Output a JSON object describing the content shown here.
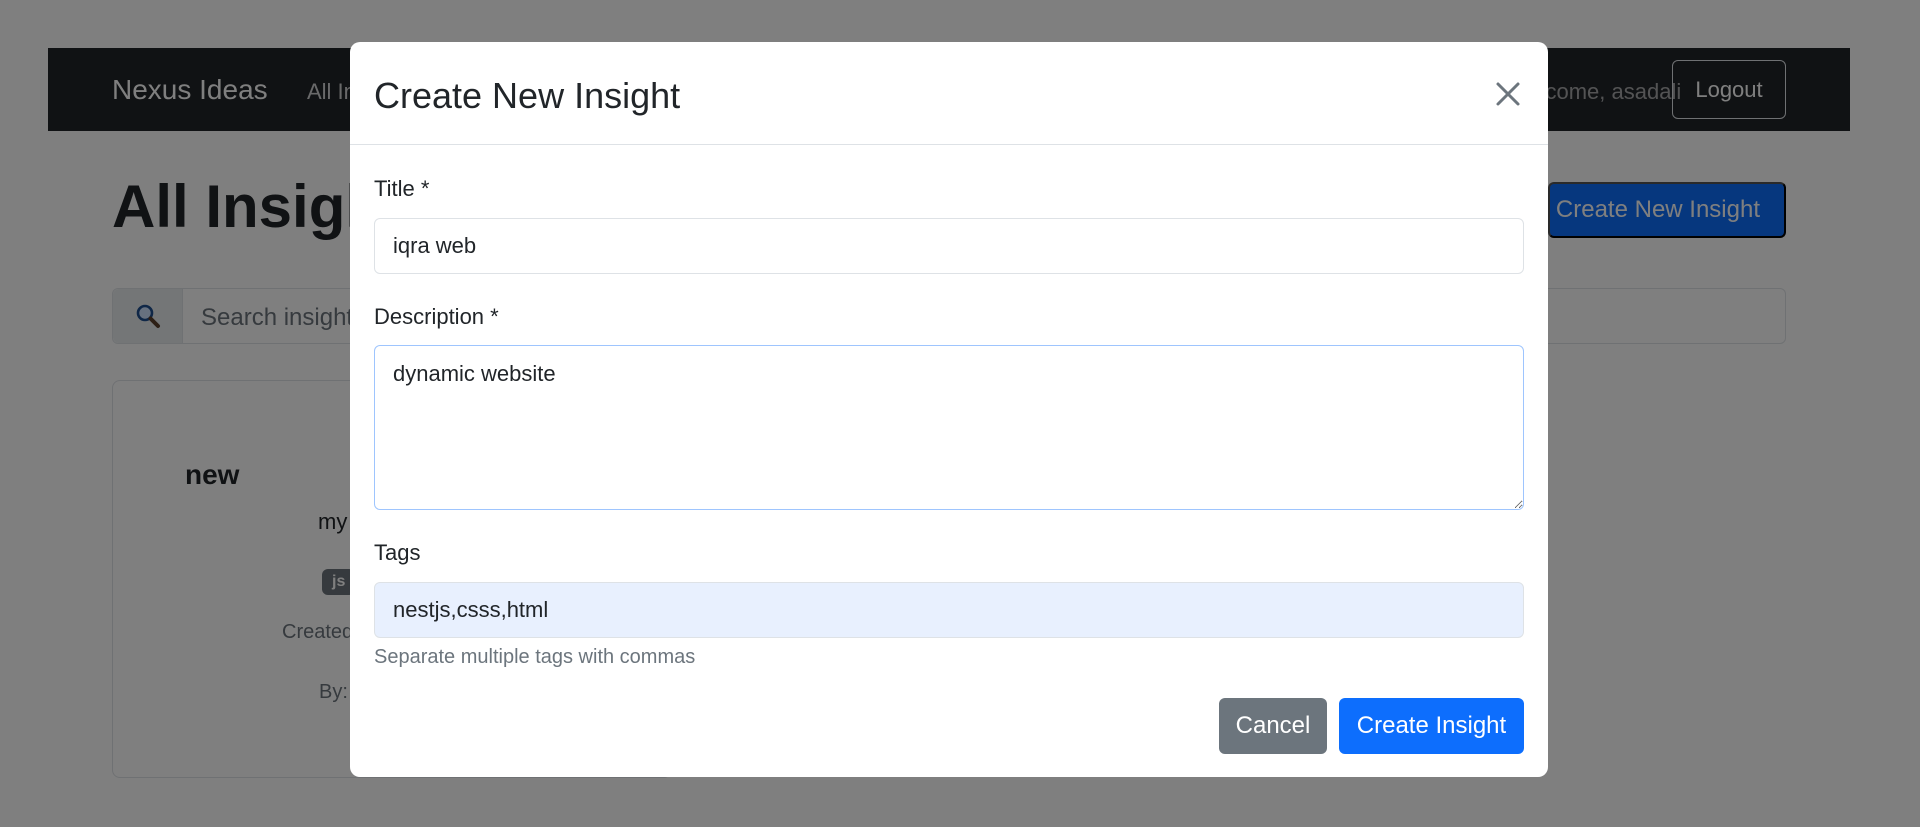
{
  "navbar": {
    "brand": "Nexus Ideas",
    "link_all": "All Insights",
    "welcome": "Welcome, asadali",
    "logout_label": "Logout"
  },
  "page": {
    "title": "All Insights",
    "create_button_label": "Create New Insight",
    "search_icon": "magnifier-icon",
    "search_placeholder": "Search insights..."
  },
  "card": {
    "title": "new",
    "description": "my",
    "tag": "js",
    "created": "Created",
    "by": "By:"
  },
  "modal": {
    "title": "Create New Insight",
    "close_icon": "close-icon",
    "title_label": "Title *",
    "title_value": "iqra web",
    "description_label": "Description *",
    "description_value": "dynamic website",
    "tags_label": "Tags",
    "tags_value": "nestjs,csss,html",
    "tags_help": "Separate multiple tags with commas",
    "cancel_label": "Cancel",
    "submit_label": "Create Insight"
  },
  "colors": {
    "primary": "#0d6efd",
    "secondary": "#6c757d",
    "navbar_bg": "#212529",
    "backdrop": "rgba(0,0,0,0.5)"
  }
}
